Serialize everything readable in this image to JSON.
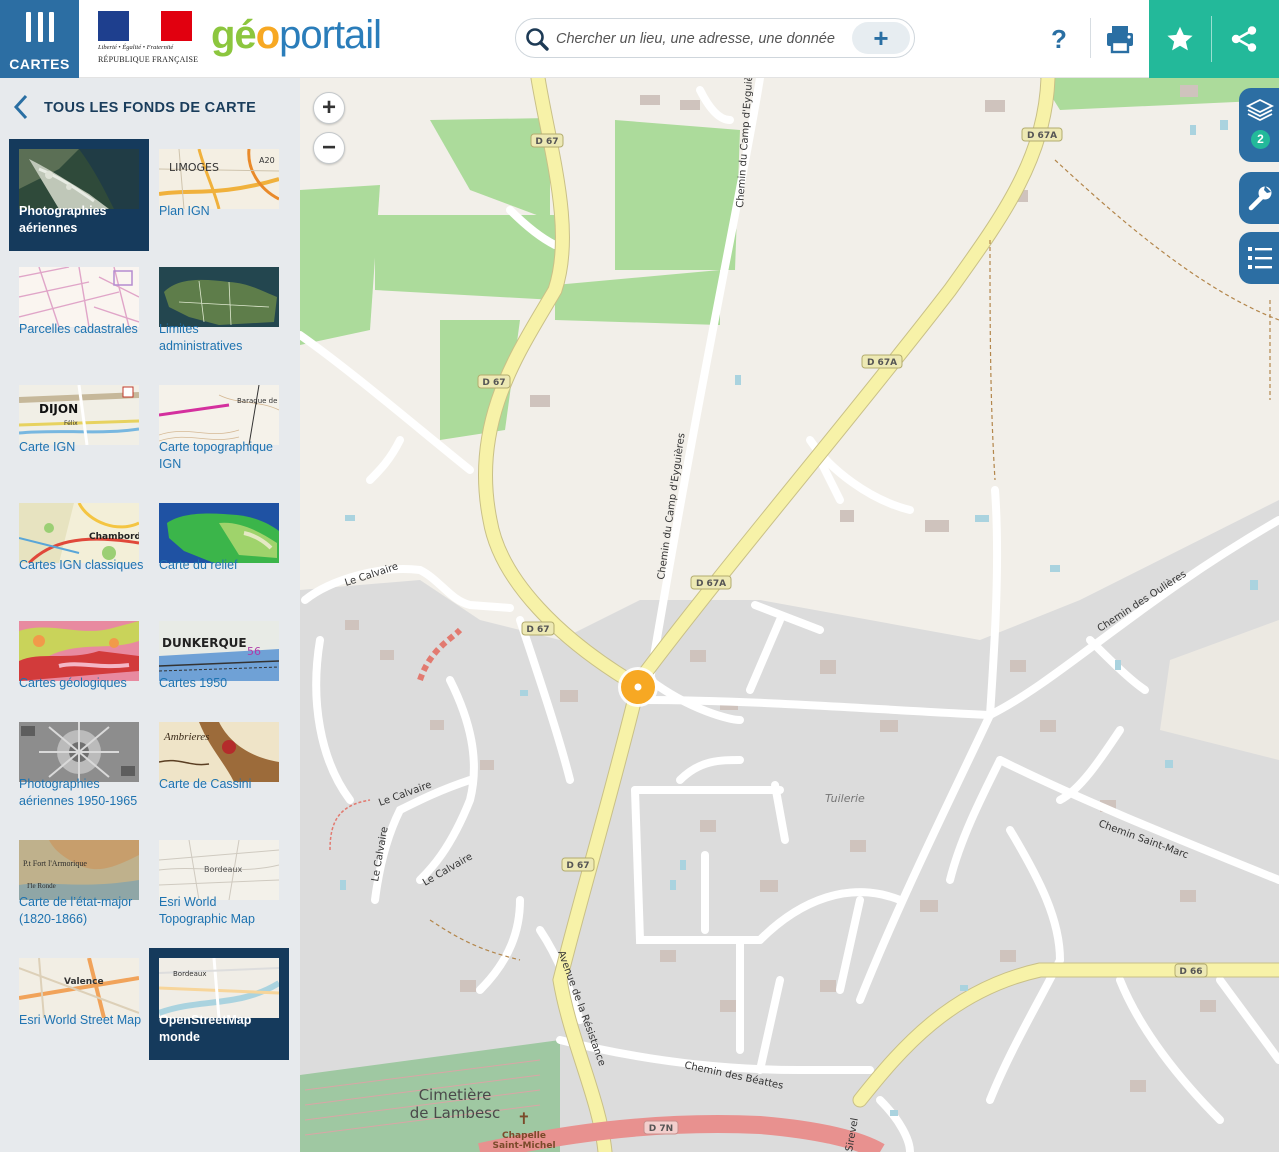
{
  "header": {
    "menu_label": "CARTES",
    "republic_motto": "Liberté • Égalité • Fraternité",
    "republic_name": "RÉPUBLIQUE FRANÇAISE",
    "brand_geo": "gé",
    "brand_o": "o",
    "brand_portail": "portail",
    "search_placeholder": "Chercher un lieu, une adresse, une donnée",
    "search_add": "+",
    "help": "?"
  },
  "panel": {
    "title": "TOUS LES FONDS DE CARTE",
    "tiles": [
      {
        "label": "Photographies aériennes",
        "selected": true
      },
      {
        "label": "Plan IGN"
      },
      {
        "label": "Parcelles cadastrales"
      },
      {
        "label": "Limites administratives"
      },
      {
        "label": "Carte IGN"
      },
      {
        "label": "Carte topographique IGN"
      },
      {
        "label": "Cartes IGN classiques"
      },
      {
        "label": "Carte du relief"
      },
      {
        "label": "Cartes géologiques"
      },
      {
        "label": "Cartes 1950"
      },
      {
        "label": "Photographies aériennes 1950-1965"
      },
      {
        "label": "Carte de Cassini"
      },
      {
        "label": "Carte de l’état-major (1820-1866)"
      },
      {
        "label": "Esri World Topographic Map"
      },
      {
        "label": "Esri World Street Map"
      },
      {
        "label": "OpenStreetMap monde",
        "selected": true
      }
    ],
    "thumb_texts": {
      "limoges": "LIMOGES",
      "a20": "A20",
      "dijon": "DIJON",
      "felix": "Félix",
      "baraque": "Baraque de l'Estrade",
      "chambord": "Chambord",
      "dunkerque": "DUNKERQUE",
      "ambrieres": "Ambrieres",
      "fort": "P.t Fort l'Armorique",
      "ronde": "I'le Ronde",
      "bordeaux": "Bordeaux",
      "valence": "Valence"
    }
  },
  "map": {
    "zoom_in": "+",
    "zoom_out": "−",
    "layers_count": "2",
    "labels": {
      "d67": "D 67",
      "d67a": "D 67A",
      "d66": "D 66",
      "d7n": "D 7N",
      "chemin_camp": "Chemin du Camp d'Eyguières",
      "chemin_camp_upper": "Chemin du Camp d'Eyguière",
      "le_calvaire": "Le Calvaire",
      "tuilerie": "Tuilerie",
      "chemin_oulieres": "Chemin des Oulières",
      "chemin_saint_marc": "Chemin Saint-Marc",
      "avenue_resistance": "Avenue de la Résistance",
      "chemin_beattes": "Chemin des Béattes",
      "cimetiere_1": "Cimetière",
      "cimetiere_2": "de Lambesc",
      "chapelle_1": "Chapelle",
      "chapelle_2": "Saint-Michel",
      "sirevel": "Sirevel"
    }
  },
  "colors": {
    "brand_blue": "#2c6ea3",
    "accent_green": "#23b99a",
    "selected_tile": "#153a5c",
    "link_blue": "#1e73b0"
  }
}
